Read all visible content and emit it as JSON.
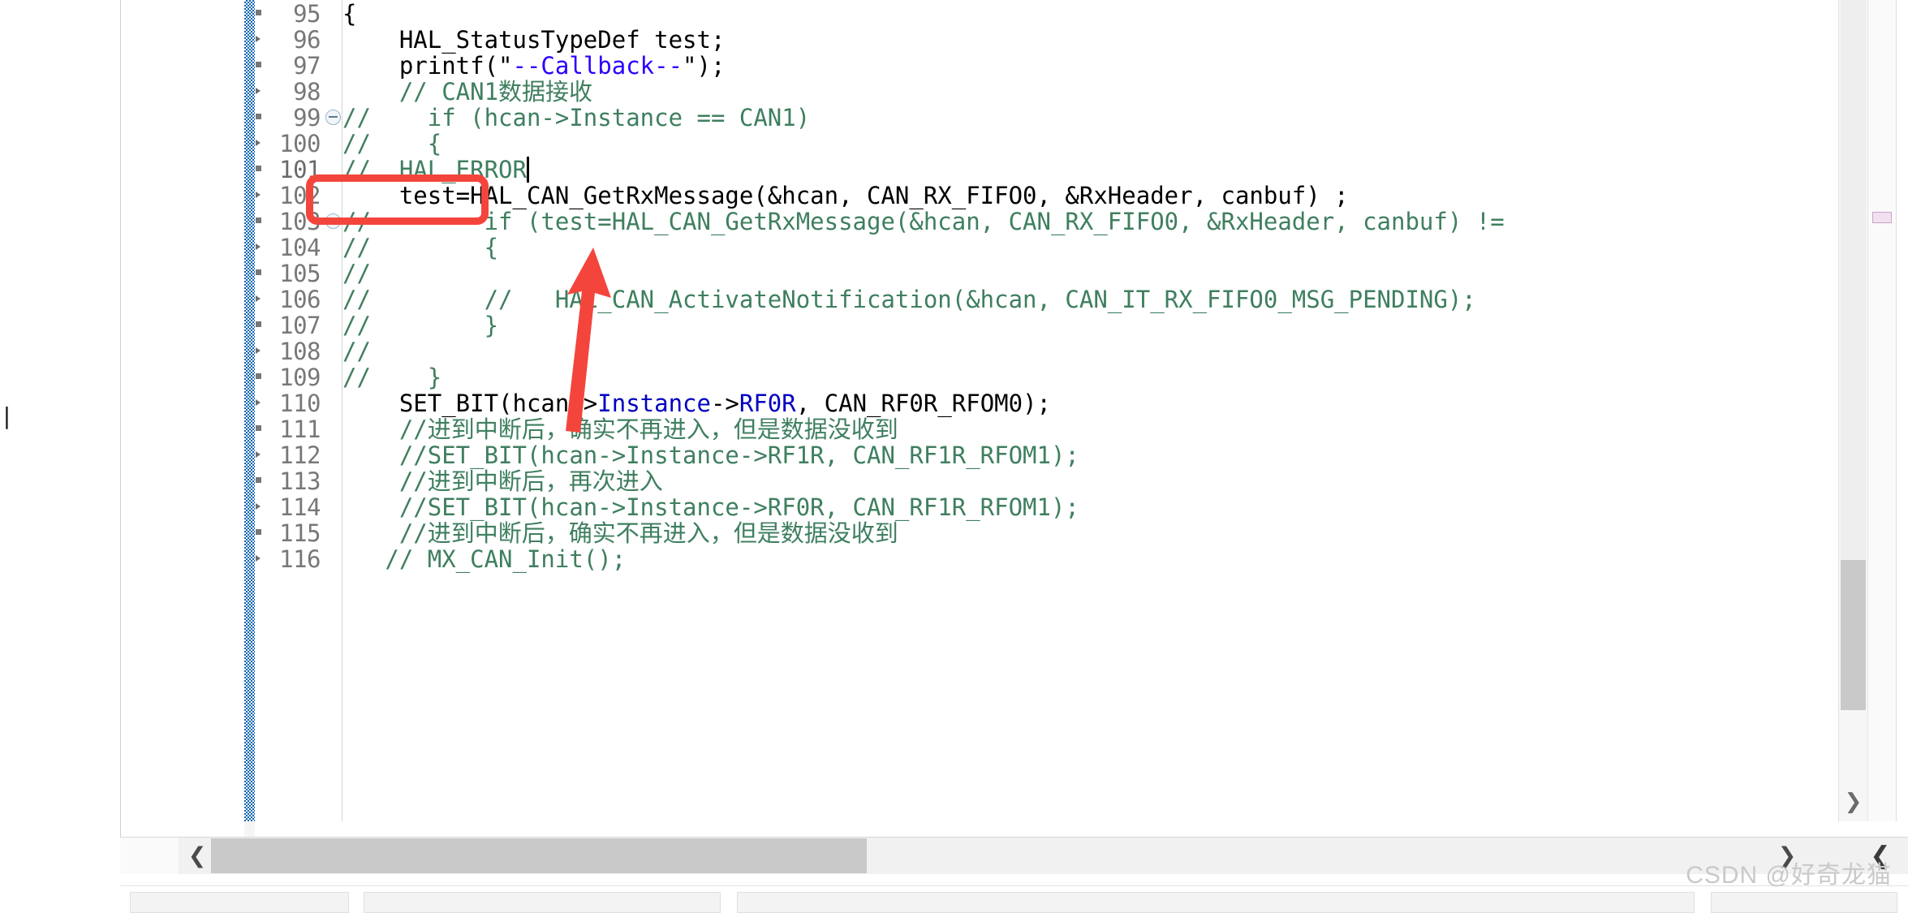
{
  "editor": {
    "type": "code-editor",
    "language": "C",
    "first_visible_line": 95,
    "last_visible_line": 116,
    "current_line": 101,
    "lines": [
      {
        "number": "95",
        "folding": false,
        "indent": 0,
        "segments": [
          {
            "text": "{",
            "style": "plain"
          }
        ]
      },
      {
        "number": "96",
        "folding": false,
        "indent": 0,
        "segments": [
          {
            "text": "    HAL_StatusTypeDef test;",
            "style": "plain"
          }
        ]
      },
      {
        "number": "97",
        "folding": false,
        "indent": 0,
        "segments": [
          {
            "text": "    printf(\"",
            "style": "plain"
          },
          {
            "text": "--Callback--",
            "style": "string"
          },
          {
            "text": "\");",
            "style": "plain"
          }
        ]
      },
      {
        "number": "98",
        "folding": false,
        "indent": 0,
        "segments": [
          {
            "text": "    // CAN1数据接收",
            "style": "comment"
          }
        ]
      },
      {
        "number": "99",
        "folding": true,
        "indent": 0,
        "segments": [
          {
            "text": "//    if (hcan->Instance == CAN1)",
            "style": "comment",
            "squiggle": "hcan"
          }
        ]
      },
      {
        "number": "100",
        "folding": false,
        "indent": 0,
        "segments": [
          {
            "text": "//    {",
            "style": "comment"
          }
        ]
      },
      {
        "number": "101",
        "folding": false,
        "indent": 0,
        "current": true,
        "segments": [
          {
            "text": "//  HAL_ERROR",
            "style": "comment"
          }
        ]
      },
      {
        "number": "102",
        "folding": false,
        "indent": 0,
        "segments": [
          {
            "text": "    test=HAL_CAN_GetRxMessage(&hcan, CAN_RX_FIFO0, &RxHeader, canbuf) ;",
            "style": "plain"
          }
        ]
      },
      {
        "number": "103",
        "folding": true,
        "indent": 0,
        "segments": [
          {
            "text": "//        if (test=HAL_CAN_GetRxMessage(&hcan, CAN_RX_FIFO0, &RxHeader, canbuf) !=",
            "style": "comment"
          }
        ]
      },
      {
        "number": "104",
        "folding": false,
        "indent": 0,
        "segments": [
          {
            "text": "//        {",
            "style": "comment"
          }
        ]
      },
      {
        "number": "105",
        "folding": false,
        "indent": 0,
        "segments": [
          {
            "text": "//",
            "style": "comment"
          }
        ]
      },
      {
        "number": "106",
        "folding": false,
        "indent": 0,
        "segments": [
          {
            "text": "//        //   HAL_CAN_ActivateNotification(&hcan, CAN_IT_RX_FIFO0_MSG_PENDING);",
            "style": "comment"
          }
        ]
      },
      {
        "number": "107",
        "folding": false,
        "indent": 0,
        "segments": [
          {
            "text": "//        }",
            "style": "comment"
          }
        ]
      },
      {
        "number": "108",
        "folding": false,
        "indent": 0,
        "segments": [
          {
            "text": "//",
            "style": "comment"
          }
        ]
      },
      {
        "number": "109",
        "folding": false,
        "indent": 0,
        "segments": [
          {
            "text": "//    }",
            "style": "comment"
          }
        ]
      },
      {
        "number": "110",
        "folding": false,
        "indent": 0,
        "segments": [
          {
            "text": "    SET_BIT(hcan->",
            "style": "plain"
          },
          {
            "text": "Instance",
            "style": "field"
          },
          {
            "text": "->",
            "style": "plain"
          },
          {
            "text": "RF0R",
            "style": "field"
          },
          {
            "text": ", CAN_RF0R_RFOM0);",
            "style": "plain"
          }
        ]
      },
      {
        "number": "111",
        "folding": false,
        "indent": 0,
        "segments": [
          {
            "text": "    //进到中断后，确实不再进入，但是数据没收到",
            "style": "comment"
          }
        ]
      },
      {
        "number": "112",
        "folding": false,
        "indent": 0,
        "segments": [
          {
            "text": "    //SET_BIT(hcan->Instance->RF1R, CAN_RF1R_RFOM1);",
            "style": "comment"
          }
        ]
      },
      {
        "number": "113",
        "folding": false,
        "indent": 0,
        "segments": [
          {
            "text": "    //进到中断后，再次进入",
            "style": "comment"
          }
        ]
      },
      {
        "number": "114",
        "folding": false,
        "indent": 0,
        "segments": [
          {
            "text": "    //SET_BIT(hcan->Instance->RF0R, CAN_RF1R_RFOM1);",
            "style": "comment"
          }
        ]
      },
      {
        "number": "115",
        "folding": false,
        "indent": 0,
        "segments": [
          {
            "text": "    //进到中断后，确实不再进入，但是数据没收到",
            "style": "comment"
          }
        ]
      },
      {
        "number": "116",
        "folding": false,
        "indent": 0,
        "segments": [
          {
            "text": "   // MX_CAN_Init();",
            "style": "comment"
          }
        ]
      }
    ]
  },
  "annotation": {
    "highlight_target_line": "102",
    "highlight_target_text": "test=",
    "box_color": "#f4453c",
    "arrow_color": "#f4453c",
    "arrow_points_to_line": "101"
  },
  "scrollbars": {
    "vertical_down_arrow": "❯",
    "horizontal_left_arrow": "❮",
    "horizontal_right_arrow": "❯",
    "horizontal_far_right_arrow": "❮"
  },
  "colors": {
    "comment": "#3f7f5f",
    "string": "#2a00ff",
    "field": "#0000c0",
    "plain": "#000000",
    "current_line_bg": "#e8f2fd",
    "current_line_number_bg": "#f4e3f2",
    "change_bar": "#0a64b4",
    "scroll_thumb": "#c9c9c9"
  },
  "watermark": {
    "text": "CSDN @好奇龙猫"
  },
  "stray": {
    "left_margin_glyph": "|"
  }
}
